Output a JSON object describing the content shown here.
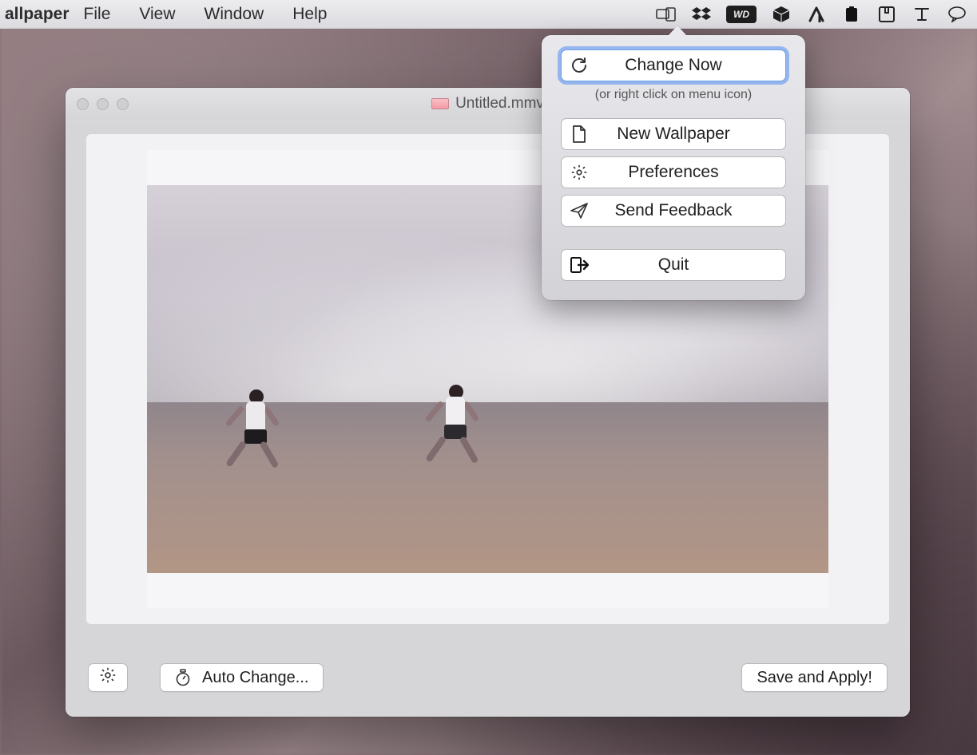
{
  "menubar": {
    "app_name": "allpaper",
    "items": [
      "File",
      "View",
      "Window",
      "Help"
    ],
    "status_icons": [
      "displays-icon",
      "dropbox-icon",
      "wd-icon",
      "cube-icon",
      "triangle-icon",
      "clipboard-icon",
      "package-icon",
      "text-icon",
      "chat-icon"
    ]
  },
  "window": {
    "title": "Untitled.mmv",
    "settings_btn": "",
    "auto_change_btn": "Auto Change...",
    "save_apply_btn": "Save and Apply!"
  },
  "popover": {
    "change_now": "Change Now",
    "hint": "(or right click on menu icon)",
    "new_wallpaper": "New Wallpaper",
    "preferences": "Preferences",
    "send_feedback": "Send Feedback",
    "quit": "Quit"
  }
}
